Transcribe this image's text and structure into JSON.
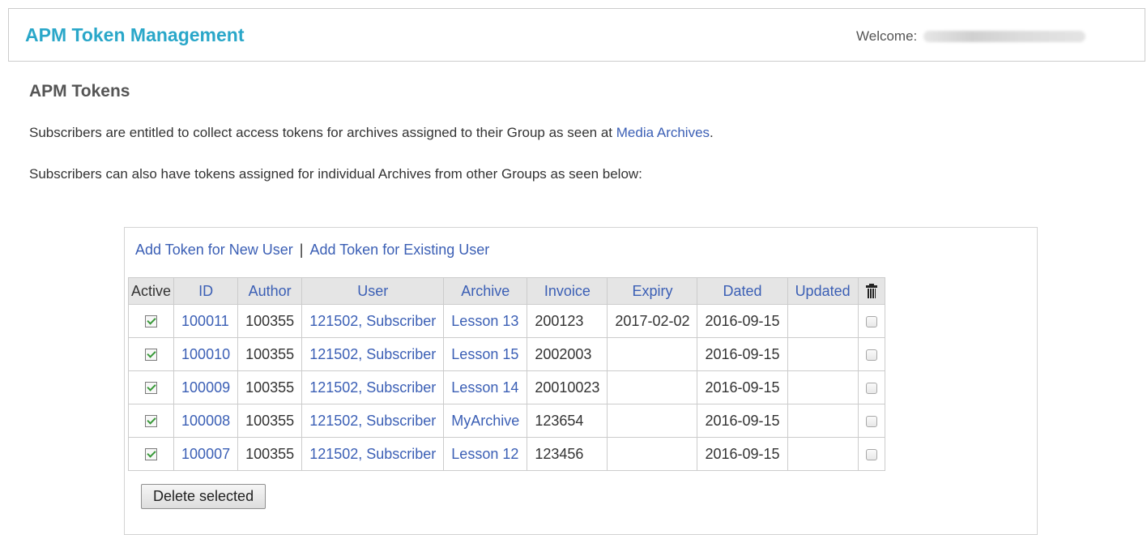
{
  "header": {
    "app_title": "APM Token Management",
    "welcome_label": "Welcome:"
  },
  "page": {
    "heading": "APM Tokens",
    "para1_text": "Subscribers are entitled to collect access tokens for archives assigned to their Group as seen at ",
    "para1_link": "Media Archives",
    "para1_end": ".",
    "para2_text": "Subscribers can also have tokens assigned for individual Archives from other Groups as seen below:"
  },
  "panel": {
    "add_new_user": "Add Token for New User",
    "separator": "|",
    "add_existing_user": "Add Token for Existing User",
    "delete_button": "Delete selected"
  },
  "table": {
    "columns": [
      "Active",
      "ID",
      "Author",
      "User",
      "Archive",
      "Invoice",
      "Expiry",
      "Dated",
      "Updated"
    ],
    "rows": [
      {
        "active": true,
        "id": "100011",
        "author": "100355",
        "user": "121502, Subscriber",
        "archive": "Lesson 13",
        "invoice": "200123",
        "expiry": "2017-02-02",
        "dated": "2016-09-15",
        "updated": ""
      },
      {
        "active": true,
        "id": "100010",
        "author": "100355",
        "user": "121502, Subscriber",
        "archive": "Lesson 15",
        "invoice": "2002003",
        "expiry": "",
        "dated": "2016-09-15",
        "updated": ""
      },
      {
        "active": true,
        "id": "100009",
        "author": "100355",
        "user": "121502, Subscriber",
        "archive": "Lesson 14",
        "invoice": "20010023",
        "expiry": "",
        "dated": "2016-09-15",
        "updated": ""
      },
      {
        "active": true,
        "id": "100008",
        "author": "100355",
        "user": "121502, Subscriber",
        "archive": "MyArchive",
        "invoice": "123654",
        "expiry": "",
        "dated": "2016-09-15",
        "updated": ""
      },
      {
        "active": true,
        "id": "100007",
        "author": "100355",
        "user": "121502, Subscriber",
        "archive": "Lesson 12",
        "invoice": "123456",
        "expiry": "",
        "dated": "2016-09-15",
        "updated": ""
      }
    ]
  },
  "colors": {
    "title_accent": "#2aa7c9",
    "link": "#3b5fb5",
    "header_row_bg": "#e5e5e5"
  }
}
